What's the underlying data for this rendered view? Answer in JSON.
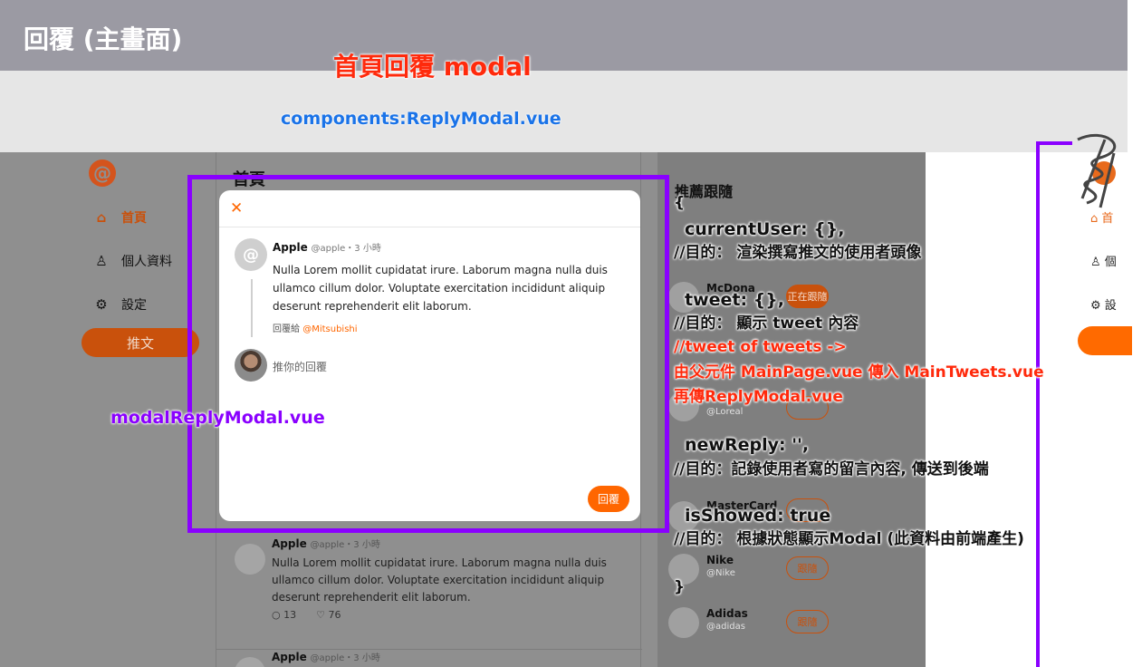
{
  "slide": {
    "title": "回覆 (主畫面)",
    "heading": "首頁回覆 modal",
    "component_path": "components:ReplyModal.vue",
    "modal_label": "modalReplyModal.vue"
  },
  "app": {
    "logo": "@",
    "nav": [
      {
        "icon": "house-icon",
        "glyph": "⌂",
        "label": "首頁"
      },
      {
        "icon": "user-icon",
        "glyph": "♙",
        "label": "個人資料"
      },
      {
        "icon": "gear-icon",
        "glyph": "⚙",
        "label": "設定"
      }
    ],
    "tweet_button": "推文",
    "feed_title": "首頁",
    "feed_tweets": [
      {
        "name": "Apple",
        "meta": "@apple・3 小時",
        "text": "Nulla Lorem mollit cupidatat irure. Laborum magna nulla duis ullamco cillum dolor. Voluptate exercitation incididunt aliquip deserunt reprehenderit elit laborum.",
        "replies": "13",
        "likes": "76"
      },
      {
        "name": "Apple",
        "meta": "@apple・3 小時"
      }
    ],
    "recommend": {
      "title": "推薦跟隨",
      "items": [
        {
          "name": "McDona",
          "handle": "",
          "button": "正在跟隨",
          "following": true
        },
        {
          "name": "",
          "handle": "@Loreal",
          "button": "",
          "following": false
        },
        {
          "name": "MasterCard",
          "handle": "",
          "button": "",
          "following": false
        },
        {
          "name": "Nike",
          "handle": "@Nike",
          "button": "跟隨",
          "following": false
        },
        {
          "name": "Adidas",
          "handle": "@adidas",
          "button": "跟隨",
          "following": false
        }
      ]
    }
  },
  "modal": {
    "close": "✕",
    "tweet": {
      "name": "Apple",
      "meta": "@apple・3 小時",
      "text": "Nulla Lorem mollit cupidatat irure. Laborum magna nulla duis ullamco cillum dolor. Voluptate exercitation incididunt aliquip deserunt reprehenderit elit laborum.",
      "reply_to_prefix": "回覆給",
      "reply_to_mention": "@Mitsubishi"
    },
    "placeholder": "推你的回覆",
    "submit": "回覆"
  },
  "annotations": {
    "open_brace": "{",
    "current_user": "currentUser: {},",
    "current_user_purpose": "//目的： 渲染撰寫推文的使用者頭像",
    "tweet": "tweet: {},",
    "tweet_purpose": "//目的： 顯示 tweet 內容",
    "tweet_source_1": "//tweet of tweets ->",
    "tweet_source_2": "由父元件 MainPage.vue 傳入 MainTweets.vue",
    "tweet_source_3": "再傳ReplyModal.vue",
    "new_reply": "newReply: '',",
    "new_reply_purpose": "//目的：記錄使用者寫的留言內容, 傳送到後端",
    "is_showed": "isShowed: true",
    "is_showed_purpose": "//目的： 根據狀態顯示Modal (此資料由前端產生)",
    "close_brace": "}"
  },
  "ghost_nav": [
    "首",
    "個",
    "設"
  ],
  "colors": {
    "accent": "#ff6600",
    "annotation_red": "#ff2a0c",
    "annotation_purple": "#8a00ff",
    "annotation_blue": "#1a73e8"
  }
}
